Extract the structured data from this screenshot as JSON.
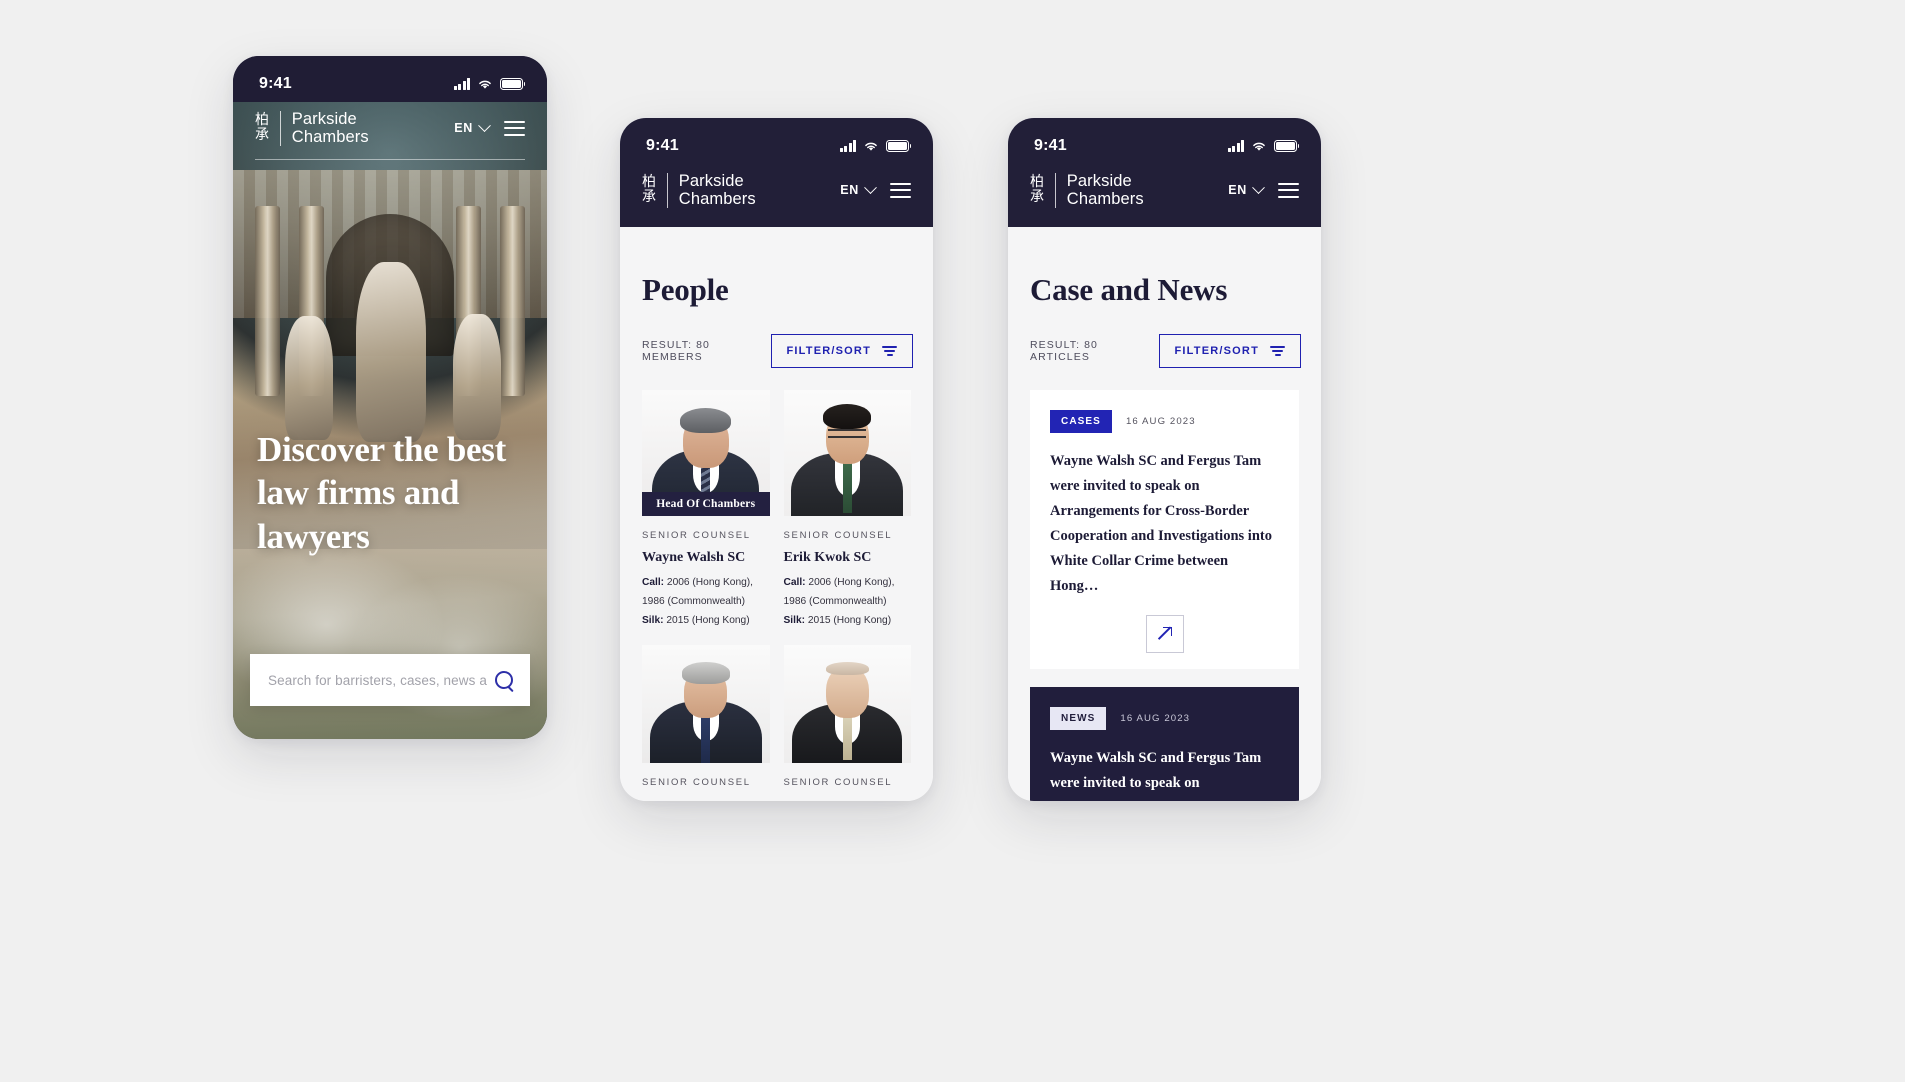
{
  "brand": {
    "cn_top": "柏",
    "cn_bottom": "承",
    "name_line1": "Parkside",
    "name_line2": "Chambers",
    "lang": "EN"
  },
  "status": {
    "time": "9:41"
  },
  "home": {
    "hero_title": "Discover the best law firms and lawyers",
    "search_placeholder": "Search for barristers, cases, news an..."
  },
  "people": {
    "title": "People",
    "result": "RESULT: 80 MEMBERS",
    "filter_label": "FILTER/SORT",
    "cards": [
      {
        "badge": "Head Of Chambers",
        "rank": "SENIOR COUNSEL",
        "name": "Wayne Walsh SC",
        "call_label": "Call:",
        "call_value": "2006 (Hong Kong), 1986 (Commonwealth)",
        "silk_label": "Silk:",
        "silk_value": "2015 (Hong Kong)"
      },
      {
        "badge": "",
        "rank": "SENIOR COUNSEL",
        "name": "Erik Kwok SC",
        "call_label": "Call:",
        "call_value": "2006 (Hong Kong), 1986 (Commonwealth)",
        "silk_label": "Silk:",
        "silk_value": "2015 (Hong Kong)"
      },
      {
        "badge": "",
        "rank": "SENIOR COUNSEL",
        "name": "",
        "call_label": "",
        "call_value": "",
        "silk_label": "",
        "silk_value": ""
      },
      {
        "badge": "",
        "rank": "SENIOR COUNSEL",
        "name": "",
        "call_label": "",
        "call_value": "",
        "silk_label": "",
        "silk_value": ""
      }
    ]
  },
  "news": {
    "title": "Case and News",
    "result": "RESULT: 80 ARTICLES",
    "filter_label": "FILTER/SORT",
    "cards": [
      {
        "tag": "CASES",
        "date": "16 AUG 2023",
        "title": "Wayne Walsh SC and Fergus Tam were invited to speak on Arrangements for Cross-Border Cooperation and Investigations into White Collar Crime between Hong…"
      },
      {
        "tag": "NEWS",
        "date": "16 AUG 2023",
        "title": "Wayne Walsh SC and Fergus Tam were invited to speak on Arrangements for Cross-Border Cooperation and Investigations into"
      }
    ]
  },
  "colors": {
    "navy": "#221f38",
    "blue": "#2224b4",
    "page_bg": "#f5f5f6",
    "canvas": "#f0f0f0"
  }
}
